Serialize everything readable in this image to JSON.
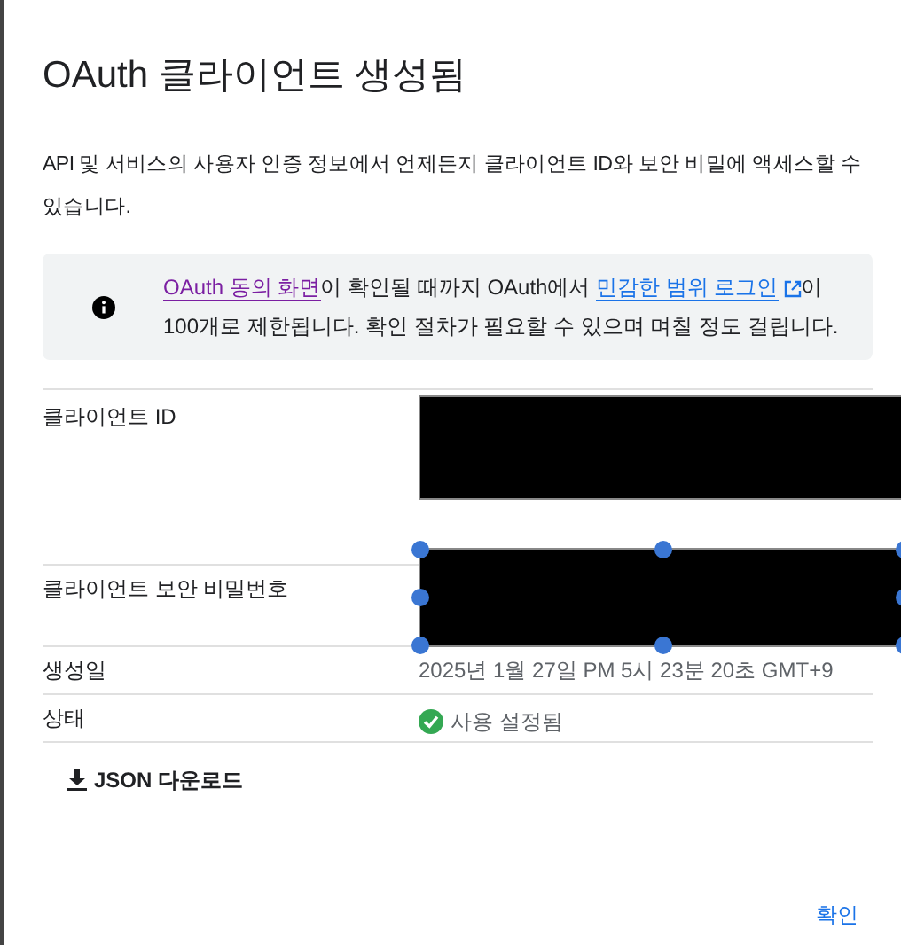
{
  "dialog": {
    "title": "OAuth 클라이언트 생성됨",
    "description": "API 및 서비스의 사용자 인증 정보에서 언제든지 클라이언트 ID와 보안 비밀에 액세스할 수 있습니다.",
    "notice": [
      {
        "kind": "link",
        "text": "OAuth 동의 화면",
        "visited": true
      },
      {
        "kind": "text",
        "text": "이 확인될 때까지 OAuth에서 "
      },
      {
        "kind": "link",
        "text": "민감한 범위 로그인",
        "visited": false,
        "external": true
      },
      {
        "kind": "text",
        "text": "이 100개로 제한됩니다. 확인 절차가 필요할 수 있으며 며칠 정도 걸립니다."
      }
    ],
    "rows": [
      {
        "label": "클라이언트 ID",
        "kind": "redacted",
        "selected": false
      },
      {
        "label": "클라이언트 보안 비밀번호",
        "kind": "redacted",
        "selected": true
      },
      {
        "label": "생성일",
        "kind": "text",
        "value": "2025년 1월 27일 PM 5시 23분 20초 GMT+9"
      },
      {
        "label": "상태",
        "kind": "status",
        "value": "사용 설정됨",
        "enabled": true
      }
    ],
    "download_button": "JSON 다운로드",
    "confirm_button": "확인"
  }
}
